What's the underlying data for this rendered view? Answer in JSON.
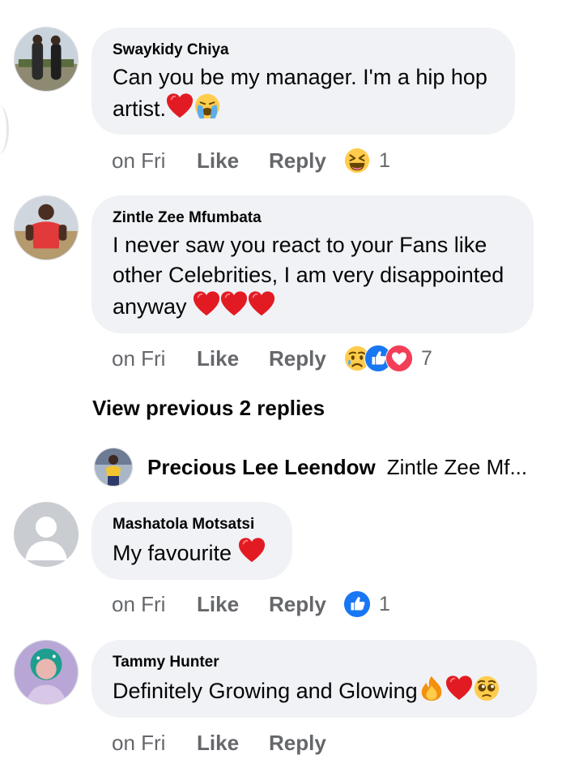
{
  "comments": [
    {
      "name": "Swaykidy Chiya",
      "line1": "Can you be my manager. I'm a hip hop",
      "line2": "artist.",
      "time": "on Fri",
      "like": "Like",
      "reply": "Reply",
      "reaction_count": "1",
      "reactions": [
        "laughing-emoji"
      ]
    },
    {
      "name": "Zintle Zee Mfumbata",
      "line1": "I never saw you react to your Fans  like",
      "line2": "other Celebrities, I am very disappointed",
      "line3": "anyway",
      "time": "on Fri",
      "like": "Like",
      "reply": "Reply",
      "reaction_count": "7",
      "reactions": [
        "sad-emoji",
        "like-icon",
        "love-icon"
      ]
    },
    {
      "name": "Mashatola Motsatsi",
      "line1": "My favourite",
      "time": "on Fri",
      "like": "Like",
      "reply": "Reply",
      "reaction_count": "1",
      "reactions": [
        "like-icon"
      ]
    },
    {
      "name": "Tammy Hunter",
      "line1": "Definitely Growing and Glowing",
      "time": "on Fri",
      "like": "Like",
      "reply": "Reply"
    }
  ],
  "view_previous": "View previous 2 replies",
  "reply_preview": {
    "name": "Precious Lee Leendow",
    "text": "Zintle Zee Mf..."
  },
  "colors": {
    "bubble": "#f0f2f5",
    "meta_text": "#65676b",
    "like_blue": "#1877f2",
    "love_red": "#f33e58",
    "heart_red": "#e21b23"
  }
}
